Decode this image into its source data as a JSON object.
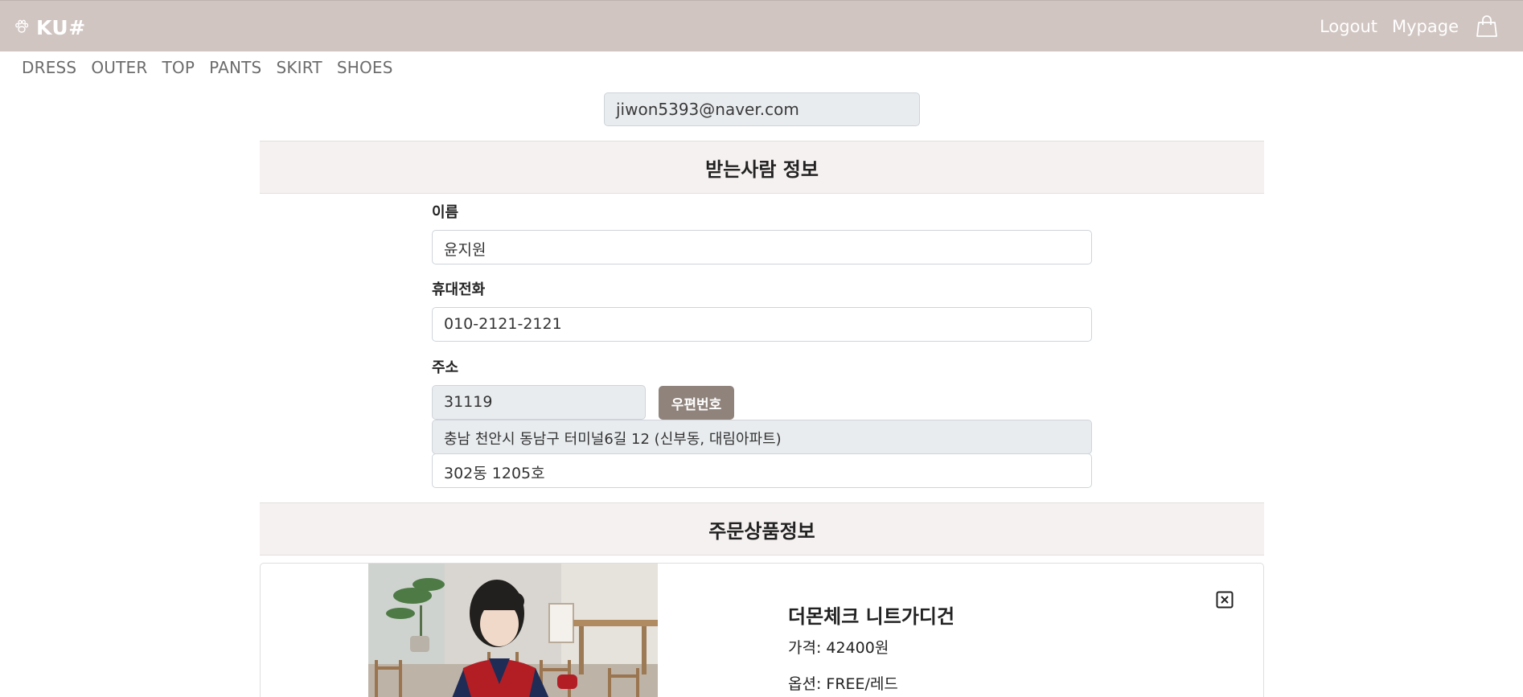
{
  "header": {
    "brand": "KU#",
    "logout_label": "Logout",
    "mypage_label": "Mypage",
    "brand_icon": "paw-icon",
    "cart_icon": "shopping-bag-icon"
  },
  "categories": [
    "DRESS",
    "OUTER",
    "TOP",
    "PANTS",
    "SKIRT",
    "SHOES"
  ],
  "orderer": {
    "email": "jiwon5393@naver.com"
  },
  "recipient": {
    "section_title": "받는사람 정보",
    "name_label": "이름",
    "name_value": "윤지원",
    "phone_label": "휴대전화",
    "phone_value": "010-2121-2121",
    "address_label": "주소",
    "zipcode": "31119",
    "zip_button": "우편번호",
    "address1": "충남 천안시 동남구 터미널6길 12 (신부동, 대림아파트)",
    "address2": "302동 1205호"
  },
  "order_items": {
    "section_title": "주문상품정보",
    "items": [
      {
        "name": "더몬체크 니트가디건",
        "price": "가격: 42400원",
        "option": "옵션: FREE/레드"
      }
    ]
  },
  "colors": {
    "topbar": "#d0c5c1",
    "section_bg": "#f5f1f0",
    "button": "#8f837c",
    "readonly_field": "#e9ecef"
  }
}
